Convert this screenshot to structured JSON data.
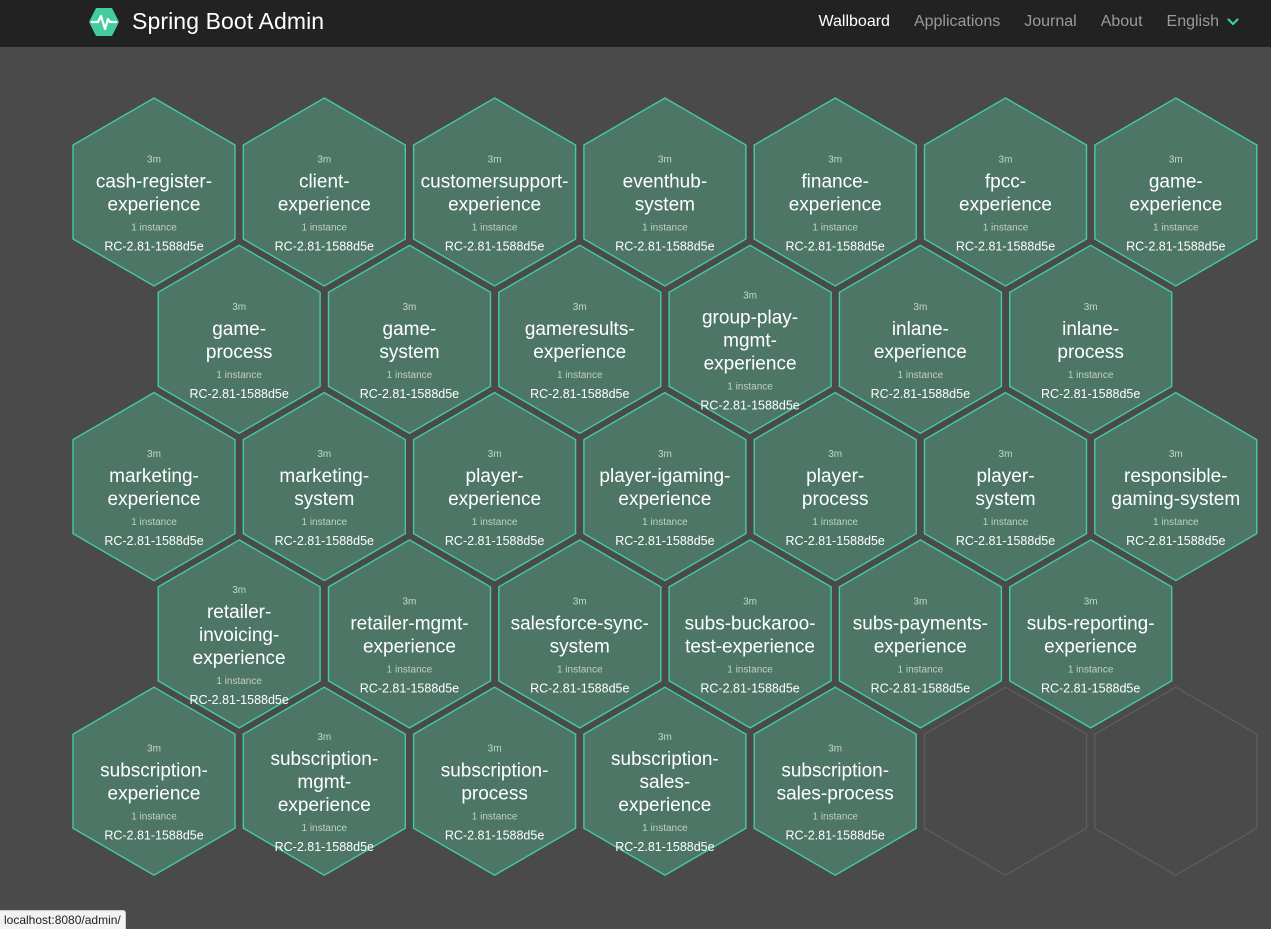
{
  "app": {
    "title": "Spring Boot Admin",
    "logo_icon": "heartbeat-hexagon-icon",
    "accent_color": "#42cca0"
  },
  "nav": {
    "items": [
      {
        "label": "Wallboard",
        "active": true
      },
      {
        "label": "Applications",
        "active": false
      },
      {
        "label": "Journal",
        "active": false
      },
      {
        "label": "About",
        "active": false
      }
    ],
    "language": "English",
    "language_icon": "chevron-down-icon"
  },
  "wallboard": {
    "applications": [
      {
        "time": "3m",
        "name_lines": [
          "cash-register-",
          "experience"
        ],
        "instances": "1 instance",
        "version": "RC-2.81-1588d5e"
      },
      {
        "time": "3m",
        "name_lines": [
          "client-",
          "experience"
        ],
        "instances": "1 instance",
        "version": "RC-2.81-1588d5e"
      },
      {
        "time": "3m",
        "name_lines": [
          "customersupport-",
          "experience"
        ],
        "instances": "1 instance",
        "version": "RC-2.81-1588d5e"
      },
      {
        "time": "3m",
        "name_lines": [
          "eventhub-",
          "system"
        ],
        "instances": "1 instance",
        "version": "RC-2.81-1588d5e"
      },
      {
        "time": "3m",
        "name_lines": [
          "finance-",
          "experience"
        ],
        "instances": "1 instance",
        "version": "RC-2.81-1588d5e"
      },
      {
        "time": "3m",
        "name_lines": [
          "fpcc-",
          "experience"
        ],
        "instances": "1 instance",
        "version": "RC-2.81-1588d5e"
      },
      {
        "time": "3m",
        "name_lines": [
          "game-",
          "experience"
        ],
        "instances": "1 instance",
        "version": "RC-2.81-1588d5e"
      },
      {
        "time": "3m",
        "name_lines": [
          "game-",
          "process"
        ],
        "instances": "1 instance",
        "version": "RC-2.81-1588d5e"
      },
      {
        "time": "3m",
        "name_lines": [
          "game-",
          "system"
        ],
        "instances": "1 instance",
        "version": "RC-2.81-1588d5e"
      },
      {
        "time": "3m",
        "name_lines": [
          "gameresults-",
          "experience"
        ],
        "instances": "1 instance",
        "version": "RC-2.81-1588d5e"
      },
      {
        "time": "3m",
        "name_lines": [
          "group-play-",
          "mgmt-",
          "experience"
        ],
        "instances": "1 instance",
        "version": "RC-2.81-1588d5e"
      },
      {
        "time": "3m",
        "name_lines": [
          "inlane-",
          "experience"
        ],
        "instances": "1 instance",
        "version": "RC-2.81-1588d5e"
      },
      {
        "time": "3m",
        "name_lines": [
          "inlane-",
          "process"
        ],
        "instances": "1 instance",
        "version": "RC-2.81-1588d5e"
      },
      {
        "time": "3m",
        "name_lines": [
          "marketing-",
          "experience"
        ],
        "instances": "1 instance",
        "version": "RC-2.81-1588d5e"
      },
      {
        "time": "3m",
        "name_lines": [
          "marketing-",
          "system"
        ],
        "instances": "1 instance",
        "version": "RC-2.81-1588d5e"
      },
      {
        "time": "3m",
        "name_lines": [
          "player-",
          "experience"
        ],
        "instances": "1 instance",
        "version": "RC-2.81-1588d5e"
      },
      {
        "time": "3m",
        "name_lines": [
          "player-igaming-",
          "experience"
        ],
        "instances": "1 instance",
        "version": "RC-2.81-1588d5e"
      },
      {
        "time": "3m",
        "name_lines": [
          "player-",
          "process"
        ],
        "instances": "1 instance",
        "version": "RC-2.81-1588d5e"
      },
      {
        "time": "3m",
        "name_lines": [
          "player-",
          "system"
        ],
        "instances": "1 instance",
        "version": "RC-2.81-1588d5e"
      },
      {
        "time": "3m",
        "name_lines": [
          "responsible-",
          "gaming-system"
        ],
        "instances": "1 instance",
        "version": "RC-2.81-1588d5e"
      },
      {
        "time": "3m",
        "name_lines": [
          "retailer-",
          "invoicing-",
          "experience"
        ],
        "instances": "1 instance",
        "version": "RC-2.81-1588d5e"
      },
      {
        "time": "3m",
        "name_lines": [
          "retailer-mgmt-",
          "experience"
        ],
        "instances": "1 instance",
        "version": "RC-2.81-1588d5e"
      },
      {
        "time": "3m",
        "name_lines": [
          "salesforce-sync-",
          "system"
        ],
        "instances": "1 instance",
        "version": "RC-2.81-1588d5e"
      },
      {
        "time": "3m",
        "name_lines": [
          "subs-buckaroo-",
          "test-experience"
        ],
        "instances": "1 instance",
        "version": "RC-2.81-1588d5e"
      },
      {
        "time": "3m",
        "name_lines": [
          "subs-payments-",
          "experience"
        ],
        "instances": "1 instance",
        "version": "RC-2.81-1588d5e"
      },
      {
        "time": "3m",
        "name_lines": [
          "subs-reporting-",
          "experience"
        ],
        "instances": "1 instance",
        "version": "RC-2.81-1588d5e"
      },
      {
        "time": "3m",
        "name_lines": [
          "subscription-",
          "experience"
        ],
        "instances": "1 instance",
        "version": "RC-2.81-1588d5e"
      },
      {
        "time": "3m",
        "name_lines": [
          "subscription-",
          "mgmt-",
          "experience"
        ],
        "instances": "1 instance",
        "version": "RC-2.81-1588d5e"
      },
      {
        "time": "3m",
        "name_lines": [
          "subscription-",
          "process"
        ],
        "instances": "1 instance",
        "version": "RC-2.81-1588d5e"
      },
      {
        "time": "3m",
        "name_lines": [
          "subscription-",
          "sales-",
          "experience"
        ],
        "instances": "1 instance",
        "version": "RC-2.81-1588d5e"
      },
      {
        "time": "3m",
        "name_lines": [
          "subscription-",
          "sales-process"
        ],
        "instances": "1 instance",
        "version": "RC-2.81-1588d5e"
      }
    ],
    "empty_slots": 2
  },
  "status_bar": {
    "url": "localhost:8080/admin/"
  }
}
